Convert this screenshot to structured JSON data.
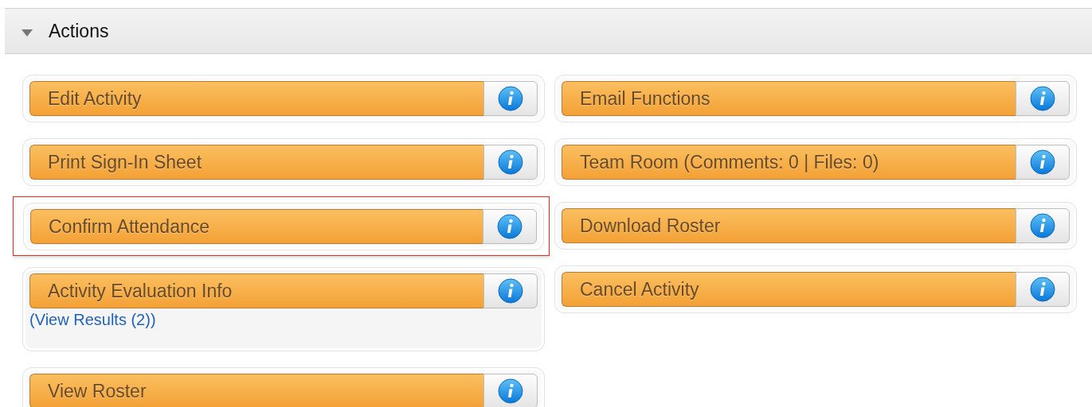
{
  "section": {
    "title": "Actions",
    "expanded": true
  },
  "columns": [
    [
      {
        "label": "Edit Activity",
        "highlighted": false
      },
      {
        "label": "Print Sign-In Sheet",
        "highlighted": false
      },
      {
        "label": "Confirm Attendance",
        "highlighted": true
      },
      {
        "label": "Activity Evaluation Info",
        "highlighted": false,
        "link": "(View Results (2))"
      },
      {
        "label": "View Roster",
        "highlighted": false
      }
    ],
    [
      {
        "label": "Email Functions",
        "highlighted": false
      },
      {
        "label": "Team Room (Comments: 0 | Files: 0)",
        "highlighted": false
      },
      {
        "label": "Download Roster",
        "highlighted": false
      },
      {
        "label": "Cancel Activity",
        "highlighted": false
      }
    ]
  ]
}
